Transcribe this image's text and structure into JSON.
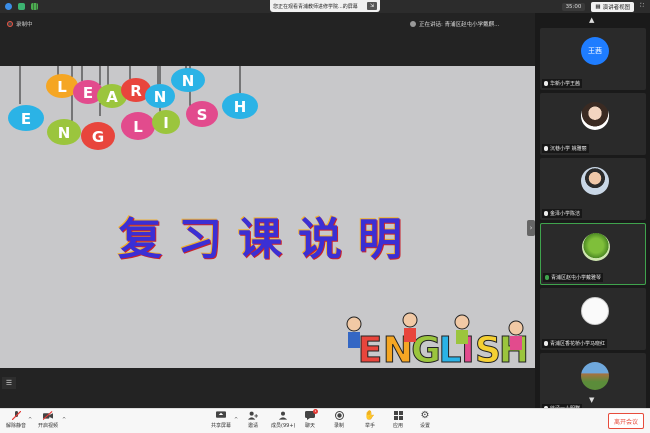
{
  "banner": {
    "text": "您正在观看青浦教师进修学院...的屏幕",
    "exit_icon": "exit-icon"
  },
  "topright": {
    "timer": "35:00",
    "view_label": "演讲者视图"
  },
  "stage": {
    "recording_label": "录制中",
    "speaking_label": "正在讲话: 青浦区赵屯小学戴麒..."
  },
  "slide": {
    "title": "复习课说明",
    "bunting_letters": [
      "L",
      "E",
      "A",
      "R",
      "N",
      "E",
      "N",
      "G",
      "L",
      "I",
      "S",
      "H"
    ],
    "bottom_word": "ENGLISH"
  },
  "participants": [
    {
      "label": "华新小学王茜",
      "avatar_text": "王茜",
      "type": "name"
    },
    {
      "label": "沉巷小学 姚雅丽",
      "type": "photo-woman"
    },
    {
      "label": "金泽小学陈洁",
      "type": "photo-child"
    },
    {
      "label": "青浦区赵屯小学戴雅琴",
      "type": "photo-plant",
      "active": true
    },
    {
      "label": "青浦区香花桥小学马晓红",
      "type": "photo-white"
    },
    {
      "label": "徐泾一小明群",
      "type": "photo-landscape"
    }
  ],
  "toolbar": {
    "mute": "解除静音",
    "video": "开启视频",
    "share": "共享屏幕",
    "invite": "邀请",
    "members": "成员(99+)",
    "chat": "聊天",
    "record": "录制",
    "raise": "举手",
    "apps": "应用",
    "settings": "设置",
    "leave": "离开会议",
    "chat_badge": "1"
  },
  "colors": {
    "leave": "#e74c3c",
    "title": "#3b2fd4",
    "avatar": "#1f7dff",
    "active_border": "#3fa34d"
  }
}
